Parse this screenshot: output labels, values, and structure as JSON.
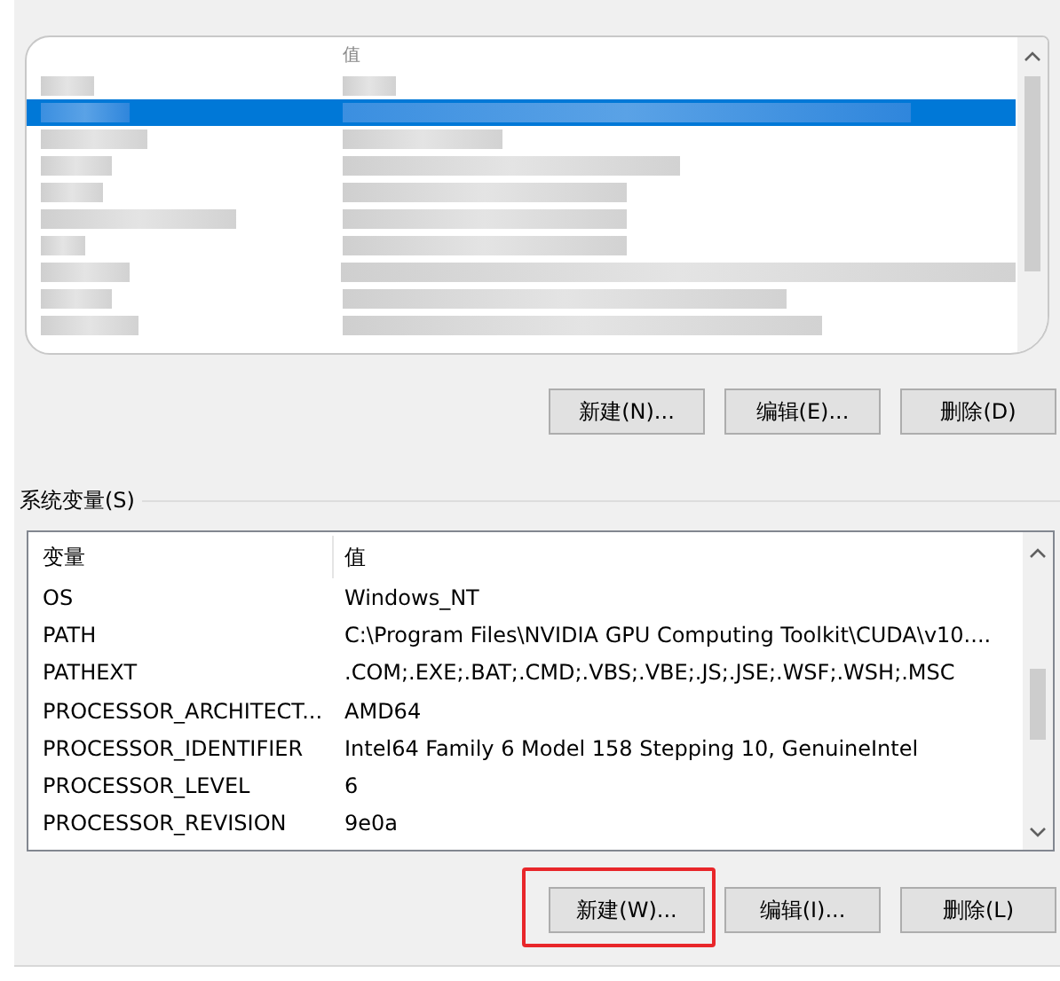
{
  "user_variables": {
    "column_2_header": "值",
    "rows": [
      {
        "selected": false
      },
      {
        "selected": true
      },
      {
        "selected": false
      },
      {
        "selected": false
      },
      {
        "selected": false
      },
      {
        "selected": false
      },
      {
        "selected": false
      },
      {
        "selected": false
      },
      {
        "selected": false
      },
      {
        "selected": false
      }
    ],
    "buttons": [
      {
        "label": "新建(N)...",
        "highlighted": false
      },
      {
        "label": "编辑(E)...",
        "highlighted": false
      },
      {
        "label": "删除(D)",
        "highlighted": false
      }
    ]
  },
  "system_variables": {
    "title": "系统变量(S)",
    "columns": [
      "变量",
      "值"
    ],
    "rows": [
      {
        "name": "OS",
        "value": "Windows_NT"
      },
      {
        "name": "PATH",
        "value": "C:\\Program Files\\NVIDIA GPU Computing Toolkit\\CUDA\\v10...."
      },
      {
        "name": "PATHEXT",
        "value": ".COM;.EXE;.BAT;.CMD;.VBS;.VBE;.JS;.JSE;.WSF;.WSH;.MSC"
      },
      {
        "name": "PROCESSOR_ARCHITECT...",
        "value": "AMD64"
      },
      {
        "name": "PROCESSOR_IDENTIFIER",
        "value": "Intel64 Family 6 Model 158 Stepping 10, GenuineIntel"
      },
      {
        "name": "PROCESSOR_LEVEL",
        "value": "6"
      },
      {
        "name": "PROCESSOR_REVISION",
        "value": "9e0a"
      }
    ],
    "buttons": [
      {
        "label": "新建(W)...",
        "highlighted": true
      },
      {
        "label": "编辑(I)...",
        "highlighted": false
      },
      {
        "label": "删除(L)",
        "highlighted": false
      }
    ]
  }
}
